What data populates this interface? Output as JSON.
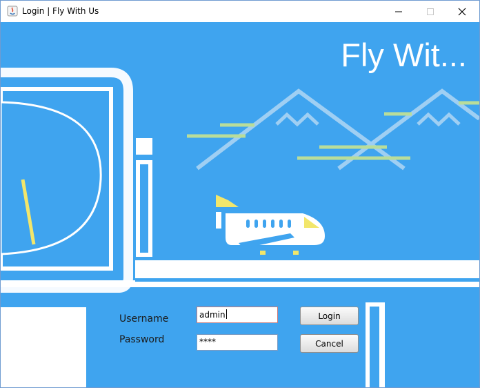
{
  "window": {
    "title": "Login | Fly With Us",
    "icon": "java-app-icon",
    "controls": [
      "minimize-icon",
      "maximize-icon",
      "close-icon"
    ]
  },
  "banner": {
    "headline": "Fly Wit..."
  },
  "form": {
    "username_label": "Username",
    "password_label": "Password",
    "username_value": "admin",
    "password_value": "****",
    "login_label": "Login",
    "cancel_label": "Cancel"
  },
  "colors": {
    "background": "#3fa4ef",
    "illustration_white": "#ffffff",
    "accent_yellow": "#f2e66b",
    "cloud_green": "#b9dd9a"
  }
}
